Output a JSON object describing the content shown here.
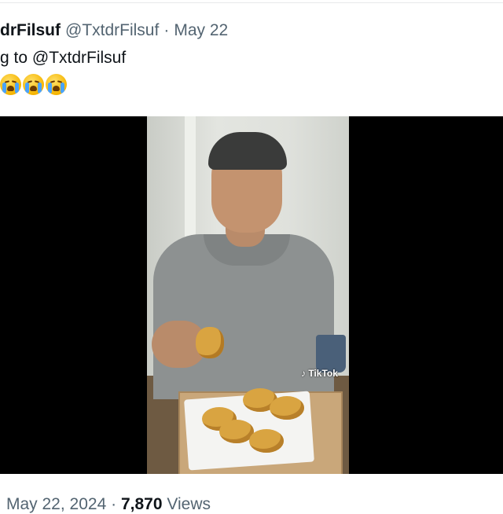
{
  "tweet": {
    "display_name": "drFilsuf",
    "handle": "@TxtdrFilsuf",
    "separator": "·",
    "date": "May 22",
    "reply_prefix": "g to",
    "reply_mention": "@TxtdrFilsuf",
    "emojis": [
      "loudly-crying-face",
      "loudly-crying-face",
      "loudly-crying-face"
    ],
    "media": {
      "watermark": "TikTok"
    },
    "meta": {
      "timestamp": "May 22, 2024",
      "separator": "·",
      "views_count": "7,870",
      "views_label": "Views"
    }
  }
}
